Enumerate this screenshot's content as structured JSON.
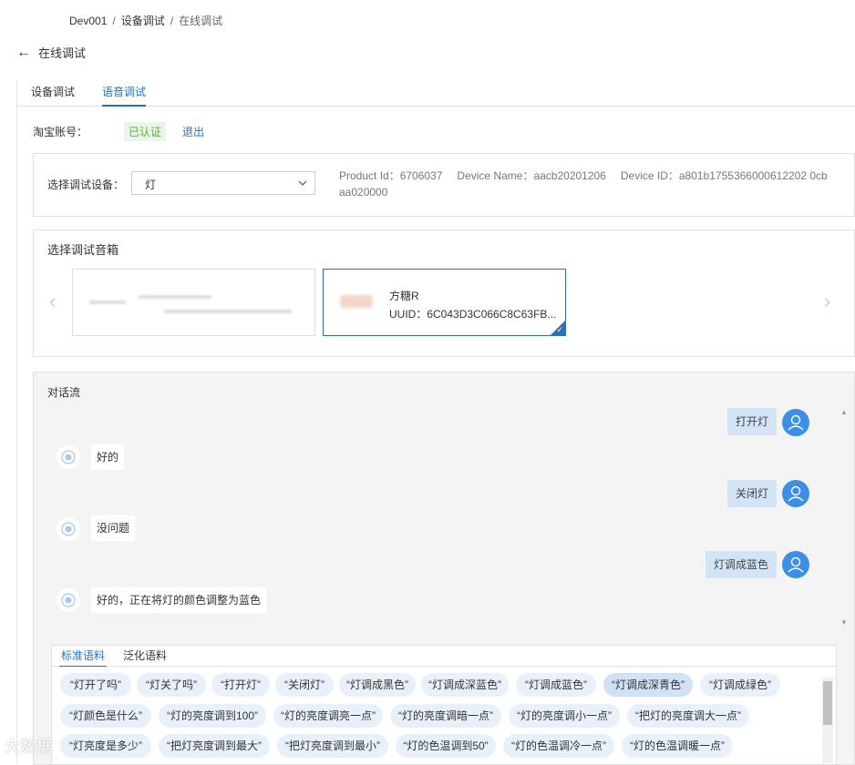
{
  "breadcrumb": {
    "items": [
      "Dev001",
      "设备调试",
      "在线调试"
    ],
    "sep": "/"
  },
  "back": {
    "arrow": "←",
    "title": "在线调试"
  },
  "tabs": [
    {
      "label": "设备调试"
    },
    {
      "label": "语音调试"
    }
  ],
  "account": {
    "label": "淘宝账号：",
    "status": "已认证",
    "logout": "退出"
  },
  "device": {
    "label": "选择调试设备：",
    "selected": "灯",
    "product_id": "Product Id：6706037",
    "device_name": "Device Name：aacb20201206",
    "device_id": "Device ID：a801b1755366000612202 0cbaa020000"
  },
  "speaker": {
    "title": "选择调试音箱",
    "prev": "‹",
    "next": "›",
    "cards": [
      {
        "name": "",
        "uuid": ""
      },
      {
        "name": "方糖R",
        "uuid": "UUID：6C043D3C066C8C63FB..."
      }
    ],
    "check": "✓"
  },
  "dialog": {
    "title": "对话流",
    "messages": [
      {
        "role": "user",
        "text": "打开灯"
      },
      {
        "role": "bot",
        "text": "好的"
      },
      {
        "role": "user",
        "text": "关闭灯"
      },
      {
        "role": "bot",
        "text": "没问题"
      },
      {
        "role": "user",
        "text": "灯调成蓝色"
      },
      {
        "role": "bot",
        "text": "好的，正在将灯的颜色调整为蓝色"
      }
    ],
    "scroll_up": "▲",
    "scroll_down": "▼"
  },
  "samples": {
    "tabs": [
      {
        "label": "标准语料"
      },
      {
        "label": "泛化语料"
      }
    ],
    "chips": [
      "“灯开了吗”",
      "“灯关了吗”",
      "“打开灯”",
      "“关闭灯”",
      "“灯调成黑色”",
      "“灯调成深蓝色”",
      "“灯调成蓝色”",
      "“灯调成深青色”",
      "“灯调成绿色”",
      "“灯颜色是什么”",
      "“灯的亮度调到100”",
      "“灯的亮度调亮一点”",
      "“灯的亮度调暗一点”",
      "“灯的亮度调小一点”",
      "“把灯的亮度调大一点”",
      "“灯亮度是多少”",
      "“把灯亮度调到最大”",
      "“把灯亮度调到最小”",
      "“灯的色温调到50”",
      "“灯的色温调冷一点”",
      "“灯的色温调暖一点”"
    ]
  },
  "watermark": "大数据",
  "colors": {
    "accent": "#1e73c8",
    "user_bubble": "#d3e4f7",
    "chip": "#e8f1fb",
    "verified": "#52b034"
  }
}
